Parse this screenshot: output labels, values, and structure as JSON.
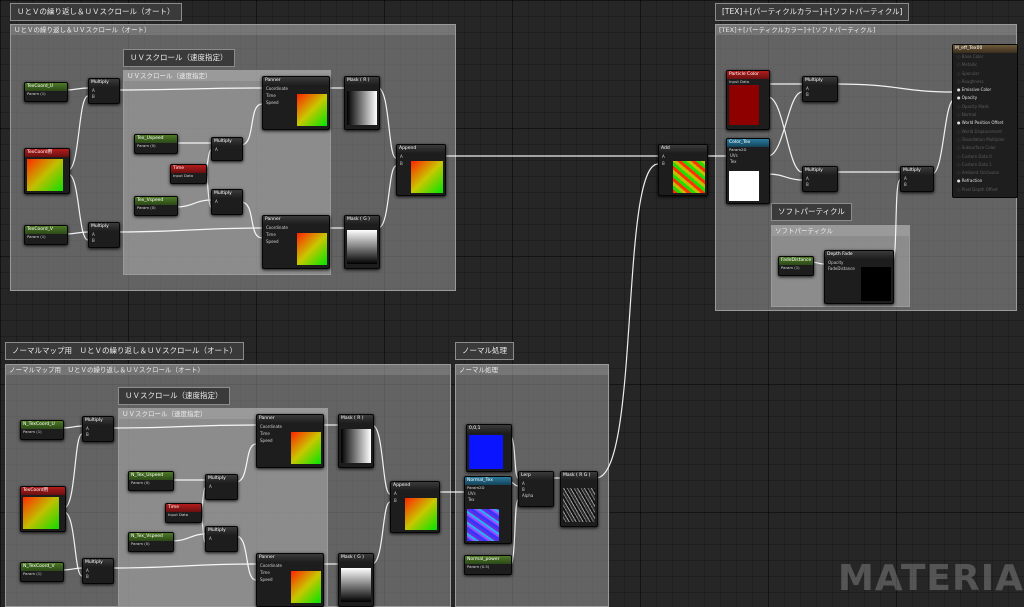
{
  "comments": {
    "uv_auto_tag": "ＵとＶの繰り返し＆ＵＶスクロール（オート）",
    "uv_auto_head": "ＵとＶの繰り返し＆ＵＶスクロール（オート）",
    "uv_speed_tag": "ＵＶスクロール（速度指定）",
    "uv_speed_head": "ＵＶスクロール（速度指定）",
    "tex_tag": "[TEX]＋[パーティクルカラー]＋[ソフトパーティクル]",
    "tex_head": "[TEX]＋[パーティクルカラー]＋[ソフトパーティクル]",
    "soft_tag": "ソフトパーティクル",
    "soft_head": "ソフトパーティクル",
    "normal_uv_tag": "ノーマルマップ用　ＵとＶの繰り返し＆ＵＶスクロール（オート）",
    "normal_uv_head": "ノーマルマップ用　ＵとＶの繰り返し＆ＵＶスクロール（オート）",
    "normal_speed_tag": "ＵＶスクロール（速度指定）",
    "normal_speed_head": "ＵＶスクロール（速度指定）",
    "normal_proc_tag": "ノーマル処理",
    "normal_proc_head": "ノーマル処理"
  },
  "nodes": {
    "texcoord_u": {
      "title": "TexCoord_U",
      "sub": "Param (1)"
    },
    "texcoord_v": {
      "title": "TexCoord_V",
      "sub": "Param (1)"
    },
    "texcoord_sample": {
      "title": "TexCoord用"
    },
    "multiply": "Multiply",
    "panner": "Panner",
    "mask_r": "Mask ( R )",
    "mask_g": "Mask ( G )",
    "append": "Append",
    "add": "Add",
    "tex_uspeed": {
      "title": "Tex_Uspeed",
      "sub": "Param (0)"
    },
    "tex_vspeed": {
      "title": "Tex_Vspeed",
      "sub": "Param (0)"
    },
    "time": {
      "title": "Time",
      "sub": "Input Data"
    },
    "particle_color": {
      "title": "Particle Color",
      "sub": "Input Data"
    },
    "color_tex": {
      "title": "Color_Tex",
      "sub": "Param2D"
    },
    "fade_distance": {
      "title": "FadeDistance",
      "sub": "Param (1)"
    },
    "depth_fade": "Depth Fade",
    "n_texcoord_u": {
      "title": "N_TexCoord_U",
      "sub": "Param (1)"
    },
    "n_texcoord_v": {
      "title": "N_TexCoord_V",
      "sub": "Param (1)"
    },
    "n_tex_uspeed": {
      "title": "N_Tex_Uspeed",
      "sub": "Param (0)"
    },
    "n_tex_vspeed": {
      "title": "N_Tex_Vspeed",
      "sub": "Param (0)"
    },
    "const3": "0,0,1",
    "normal_tex": {
      "title": "Normal_Tex",
      "sub": "Param2D"
    },
    "normal_power": {
      "title": "Normal_power",
      "sub": "Param (0.5)"
    },
    "lerp": "Lerp",
    "mask_rg": "Mask ( R G )"
  },
  "pins": {
    "a": "A",
    "b": "B",
    "coordinate": "Coordinate",
    "time": "Time",
    "speed": "Speed",
    "uvs": "UVs",
    "tex": "Tex",
    "alpha": "Alpha",
    "opacity": "Opacity",
    "fade_distance": "FadeDistance"
  },
  "result": {
    "title": "M_eff_Tex00",
    "rows": [
      {
        "label": "Base Color",
        "on": false
      },
      {
        "label": "Metallic",
        "on": false
      },
      {
        "label": "Specular",
        "on": false
      },
      {
        "label": "Roughness",
        "on": false
      },
      {
        "label": "Emissive Color",
        "on": true
      },
      {
        "label": "Opacity",
        "on": true
      },
      {
        "label": "Opacity Mask",
        "on": false
      },
      {
        "label": "Normal",
        "on": false
      },
      {
        "label": "World Position Offset",
        "on": true
      },
      {
        "label": "World Displacement",
        "on": false
      },
      {
        "label": "Tessellation Multiplier",
        "on": false
      },
      {
        "label": "Subsurface Color",
        "on": false
      },
      {
        "label": "Custom Data 0",
        "on": false
      },
      {
        "label": "Custom Data 1",
        "on": false
      },
      {
        "label": "Ambient Occlusion",
        "on": false
      },
      {
        "label": "Refraction",
        "on": true
      },
      {
        "label": "Pixel Depth Offset",
        "on": false
      }
    ]
  },
  "watermark": "MATERIA",
  "colors": {
    "wire": "#ffffff",
    "param_green": "#4d7a26",
    "input_red": "#b31c1c",
    "texture_blue": "#2a7b9e",
    "comment_gray": "#969696"
  }
}
